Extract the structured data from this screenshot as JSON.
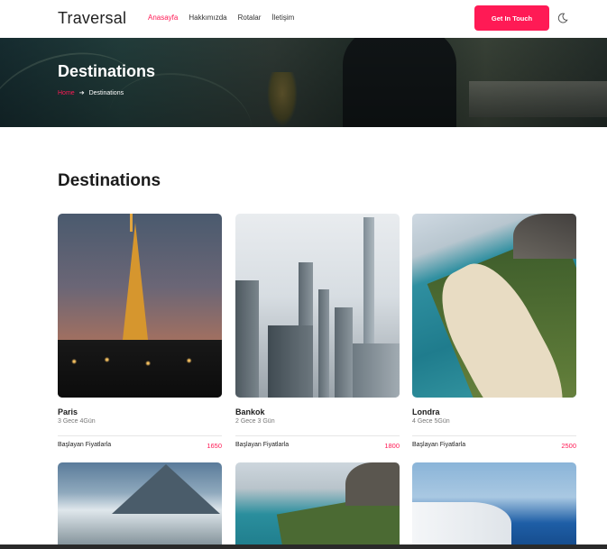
{
  "header": {
    "brand": "Traversal",
    "nav": [
      "Anasayfa",
      "Hakkımızda",
      "Rotalar",
      "İletişim"
    ],
    "cta_label": "Get In Touch",
    "theme_icon": "moon-icon"
  },
  "hero": {
    "title": "Destinations",
    "breadcrumb_home": "Home",
    "breadcrumb_separator": "➔",
    "breadcrumb_current": "Destinations"
  },
  "section": {
    "title": "Destinations"
  },
  "destinations": [
    {
      "name": "Paris",
      "duration": "3 Gece 4Gün",
      "from_label": "Başlayan Fiyatlarla",
      "price": "1650"
    },
    {
      "name": "Bankok",
      "duration": "2 Gece 3 Gün",
      "from_label": "Başlayan Fiyatlarla",
      "price": "1800"
    },
    {
      "name": "Londra",
      "duration": "4 Gece 5Gün",
      "from_label": "Başlayan Fiyatlarla",
      "price": "2500"
    }
  ],
  "colors": {
    "accent": "#ff1a55",
    "text": "#212121",
    "muted": "#777777"
  }
}
